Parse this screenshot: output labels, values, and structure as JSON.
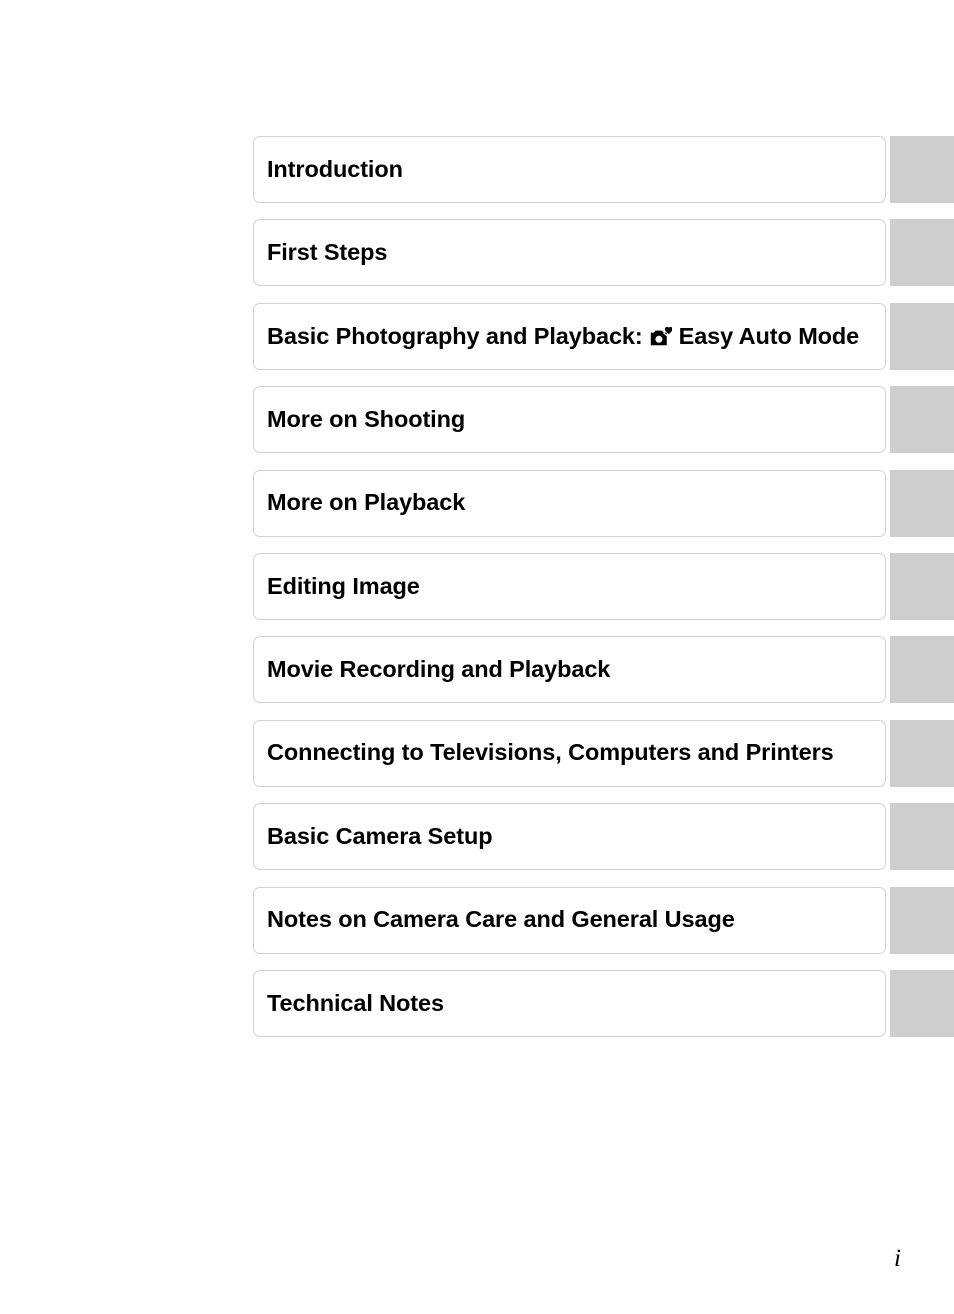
{
  "page": {
    "page_number": "i",
    "tab_color": "#cdcdcd",
    "box_border_color": "#d2d2d2",
    "text_color": "#000000"
  },
  "chapters": [
    {
      "label": "Introduction",
      "text_before": "Introduction",
      "icon": null,
      "text_after": ""
    },
    {
      "label": "First Steps",
      "text_before": "First Steps",
      "icon": null,
      "text_after": ""
    },
    {
      "label": "Basic Photography and Playback: Easy Auto Mode",
      "text_before": "Basic Photography and Playback:",
      "icon": "easy-auto-mode-camera-heart-icon",
      "text_after": "Easy Auto Mode"
    },
    {
      "label": "More on Shooting",
      "text_before": "More on Shooting",
      "icon": null,
      "text_after": ""
    },
    {
      "label": "More on Playback",
      "text_before": "More on Playback",
      "icon": null,
      "text_after": ""
    },
    {
      "label": "Editing Image",
      "text_before": "Editing Image",
      "icon": null,
      "text_after": ""
    },
    {
      "label": "Movie Recording and Playback",
      "text_before": "Movie Recording and Playback",
      "icon": null,
      "text_after": ""
    },
    {
      "label": "Connecting to Televisions, Computers and Printers",
      "text_before": "Connecting to Televisions, Computers and Printers",
      "icon": null,
      "text_after": ""
    },
    {
      "label": "Basic Camera Setup",
      "text_before": "Basic Camera Setup",
      "icon": null,
      "text_after": ""
    },
    {
      "label": "Notes on Camera Care and General Usage",
      "text_before": "Notes on Camera Care and General Usage",
      "icon": null,
      "text_after": ""
    },
    {
      "label": "Technical Notes",
      "text_before": "Technical Notes",
      "icon": null,
      "text_after": ""
    }
  ]
}
